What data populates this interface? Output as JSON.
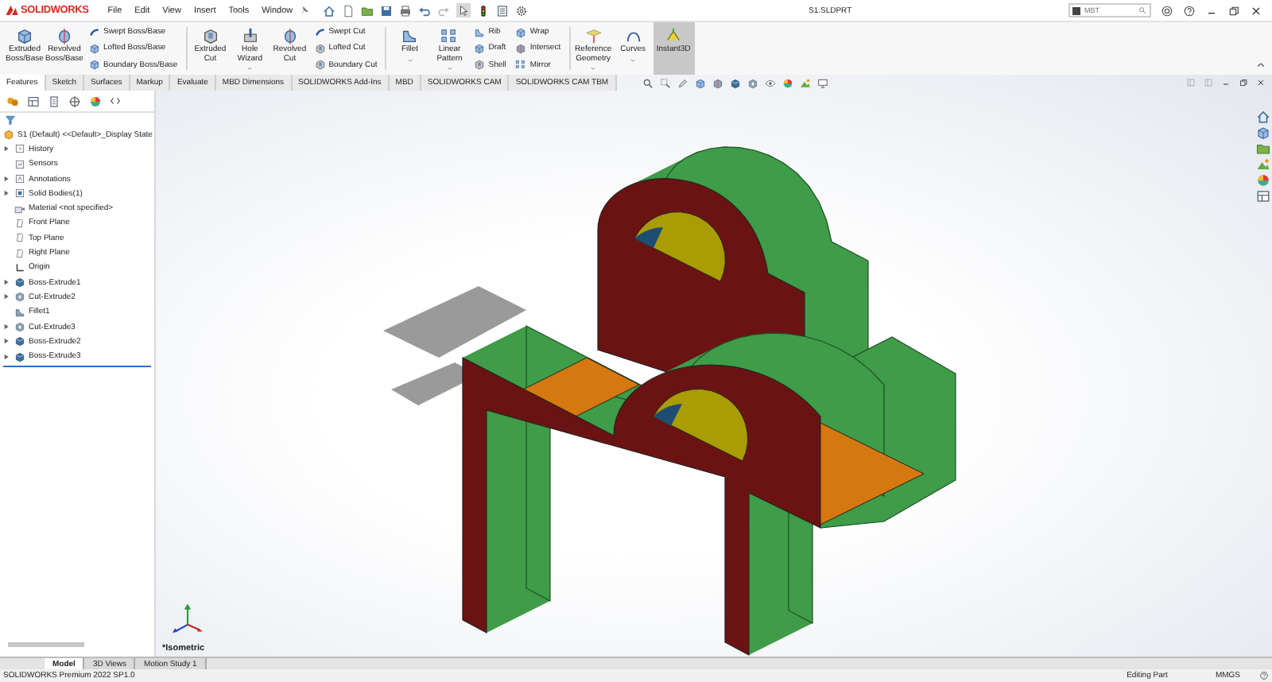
{
  "app": {
    "logo": "SOLIDWORKS",
    "menus": [
      "File",
      "Edit",
      "View",
      "Insert",
      "Tools",
      "Window"
    ],
    "document_title": "S1.SLDPRT",
    "search": {
      "placeholder": "MBT"
    }
  },
  "ribbon": [
    {
      "kind": "large",
      "label": "Extruded Boss/Base",
      "menu": false,
      "pressed": false
    },
    {
      "kind": "large",
      "label": "Revolved Boss/Base",
      "menu": false,
      "pressed": false
    },
    {
      "kind": "stack",
      "items": [
        "Swept Boss/Base",
        "Lofted Boss/Base",
        "Boundary Boss/Base"
      ]
    },
    {
      "kind": "separator"
    },
    {
      "kind": "large",
      "label": "Extruded Cut",
      "menu": false,
      "pressed": false
    },
    {
      "kind": "large",
      "label": "Hole Wizard",
      "menu": true,
      "pressed": false
    },
    {
      "kind": "large",
      "label": "Revolved Cut",
      "menu": false,
      "pressed": false
    },
    {
      "kind": "stack",
      "items": [
        "Swept Cut",
        "Lofted Cut",
        "Boundary Cut"
      ]
    },
    {
      "kind": "separator"
    },
    {
      "kind": "large",
      "label": "Fillet",
      "menu": true,
      "pressed": false
    },
    {
      "kind": "large",
      "label": "Linear Pattern",
      "menu": true,
      "pressed": false
    },
    {
      "kind": "stack",
      "items": [
        "Rib",
        "Draft",
        "Shell"
      ]
    },
    {
      "kind": "stack",
      "items": [
        "Wrap",
        "Intersect",
        "Mirror"
      ]
    },
    {
      "kind": "separator"
    },
    {
      "kind": "large",
      "label": "Reference Geometry",
      "menu": true,
      "pressed": false
    },
    {
      "kind": "large",
      "label": "Curves",
      "menu": true,
      "pressed": false
    },
    {
      "kind": "large",
      "label": "Instant3D",
      "menu": false,
      "pressed": true
    }
  ],
  "command_tabs": [
    {
      "label": "Features",
      "selected": true
    },
    {
      "label": "Sketch",
      "selected": false
    },
    {
      "label": "Surfaces",
      "selected": false
    },
    {
      "label": "Markup",
      "selected": false
    },
    {
      "label": "Evaluate",
      "selected": false
    },
    {
      "label": "MBD Dimensions",
      "selected": false
    },
    {
      "label": "SOLIDWORKS Add-Ins",
      "selected": false
    },
    {
      "label": "MBD",
      "selected": false
    },
    {
      "label": "SOLIDWORKS CAM",
      "selected": false
    },
    {
      "label": "SOLIDWORKS CAM TBM",
      "selected": false
    }
  ],
  "feature_tree": {
    "root": "S1 (Default) <<Default>_Display State",
    "items": [
      {
        "label": "History",
        "has_children": true
      },
      {
        "label": "Sensors",
        "has_children": false
      },
      {
        "label": "Annotations",
        "has_children": true
      },
      {
        "label": "Solid Bodies(1)",
        "has_children": true
      },
      {
        "label": "Material <not specified>",
        "has_children": false
      },
      {
        "label": "Front Plane",
        "has_children": false
      },
      {
        "label": "Top Plane",
        "has_children": false
      },
      {
        "label": "Right Plane",
        "has_children": false
      },
      {
        "label": "Origin",
        "has_children": false
      },
      {
        "label": "Boss-Extrude1",
        "has_children": true
      },
      {
        "label": "Cut-Extrude2",
        "has_children": true
      },
      {
        "label": "Fillet1",
        "has_children": false
      },
      {
        "label": "Cut-Extrude3",
        "has_children": true
      },
      {
        "label": "Boss-Extrude2",
        "has_children": true
      },
      {
        "label": "Boss-Extrude3",
        "has_children": true
      }
    ]
  },
  "viewport": {
    "view_name": "*Isometric"
  },
  "bottom_tabs": [
    {
      "label": "Model",
      "selected": true
    },
    {
      "label": "3D Views",
      "selected": false
    },
    {
      "label": "Motion Study 1",
      "selected": false
    }
  ],
  "status_bar": {
    "product": "SOLIDWORKS Premium 2022 SP1.0",
    "mode": "Editing Part",
    "units": "MMGS"
  }
}
